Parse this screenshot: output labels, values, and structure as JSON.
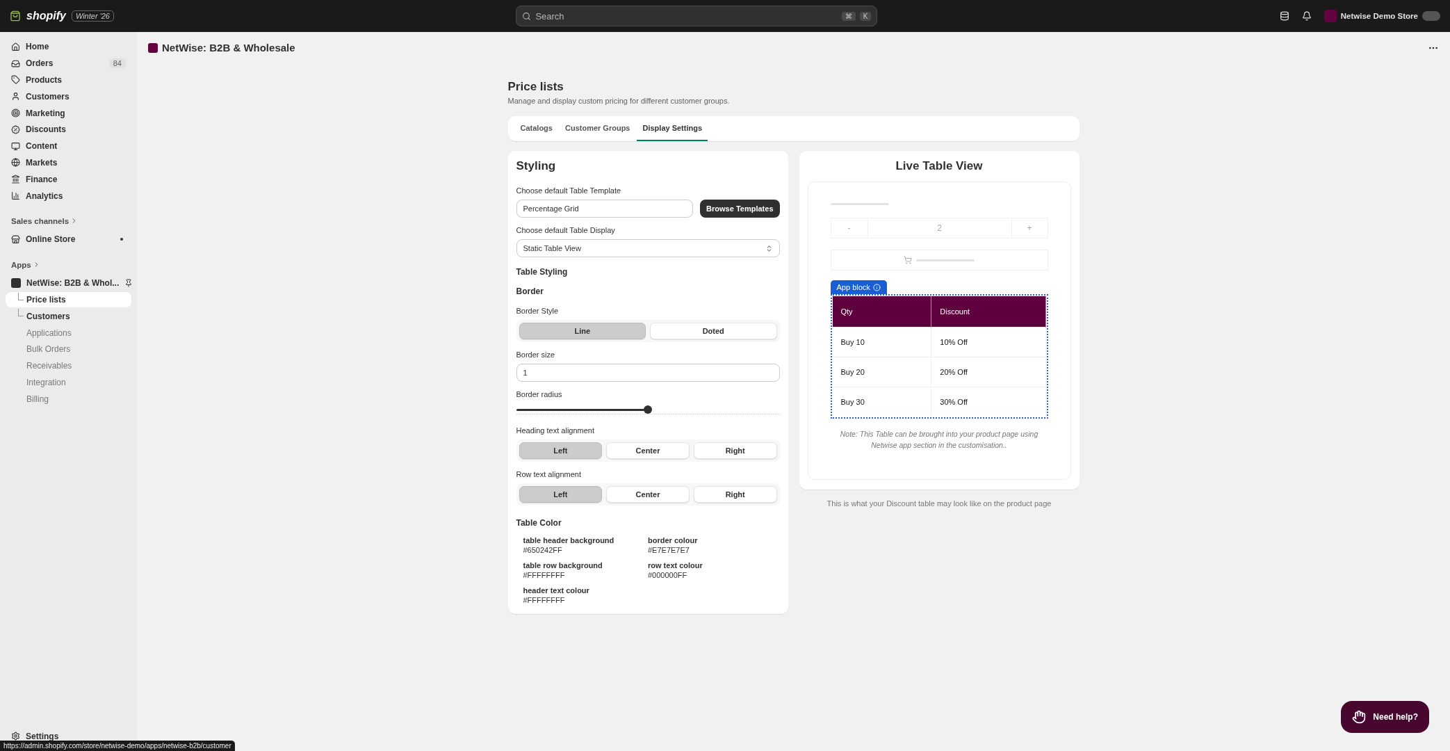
{
  "topbar": {
    "brand": "shopify",
    "edition": "Winter '26",
    "search": {
      "placeholder": "Search",
      "keys": [
        "⌘",
        "K"
      ]
    },
    "store": "Netwise Demo Store"
  },
  "sidebar": {
    "items": [
      {
        "label": "Home"
      },
      {
        "label": "Orders",
        "badge": "84"
      },
      {
        "label": "Products"
      },
      {
        "label": "Customers"
      },
      {
        "label": "Marketing"
      },
      {
        "label": "Discounts"
      },
      {
        "label": "Content"
      },
      {
        "label": "Markets"
      },
      {
        "label": "Finance"
      },
      {
        "label": "Analytics"
      }
    ],
    "sales_channels": {
      "heading": "Sales channels",
      "items": [
        {
          "label": "Online Store",
          "dot": true
        }
      ]
    },
    "apps": {
      "heading": "Apps",
      "app": {
        "label": "NetWise: B2B & Whol...",
        "pinned": true
      },
      "children": [
        {
          "label": "Price lists",
          "selected": true,
          "connector": true
        },
        {
          "label": "Customers",
          "selected": false,
          "connector": true
        },
        {
          "label": "Applications",
          "selected": false,
          "connector": false
        },
        {
          "label": "Bulk Orders",
          "selected": false,
          "connector": false
        },
        {
          "label": "Receivables",
          "selected": false,
          "connector": false
        },
        {
          "label": "Integration",
          "selected": false,
          "connector": false
        },
        {
          "label": "Billing",
          "selected": false,
          "connector": false
        }
      ]
    },
    "settings": "Settings"
  },
  "app_title": "NetWise: B2B & Wholesale",
  "page": {
    "title": "Price lists",
    "subtitle": "Manage and display custom pricing for different customer groups.",
    "tabs": [
      {
        "label": "Catalogs",
        "selected": false
      },
      {
        "label": "Customer Groups",
        "selected": false
      },
      {
        "label": "Display Settings",
        "selected": true
      }
    ]
  },
  "styling": {
    "title": "Styling",
    "template_label": "Choose default Table Template",
    "template_value": "Percentage Grid",
    "browse_button": "Browse Templates",
    "display_label": "Choose default Table Display",
    "display_value": "Static Table View",
    "table_styling": "Table Styling",
    "border_heading": "Border",
    "border_style": {
      "label": "Border Style",
      "options": [
        {
          "label": "Line",
          "selected": true
        },
        {
          "label": "Doted",
          "selected": false
        }
      ]
    },
    "border_size": {
      "label": "Border size",
      "value": "1"
    },
    "border_radius": {
      "label": "Border radius",
      "level": 0.5
    },
    "heading_alignment": {
      "label": "Heading text alignment",
      "options": [
        {
          "label": "Left",
          "selected": true
        },
        {
          "label": "Center",
          "selected": false
        },
        {
          "label": "Right",
          "selected": false
        }
      ]
    },
    "row_alignment": {
      "label": "Row text alignment",
      "options": [
        {
          "label": "Left",
          "selected": true
        },
        {
          "label": "Center",
          "selected": false
        },
        {
          "label": "Right",
          "selected": false
        }
      ]
    },
    "table_color": {
      "heading": "Table Color",
      "items": [
        {
          "label": "table header background",
          "value": "#650242FF"
        },
        {
          "label": "border colour",
          "value": "#E7E7E7E7"
        },
        {
          "label": "table row background",
          "value": "#FFFFFFFF"
        },
        {
          "label": "row text colour",
          "value": "#000000FF"
        },
        {
          "label": "header text colour",
          "value": "#FFFFFFFF"
        }
      ]
    }
  },
  "preview": {
    "title": "Live Table View",
    "quantity": {
      "minus": "-",
      "value": "2",
      "plus": "+"
    },
    "app_block": "App block",
    "columns": [
      "Qty",
      "Discount"
    ],
    "rows": [
      [
        "Buy 10",
        "10% Off"
      ],
      [
        "Buy 20",
        "20% Off"
      ],
      [
        "Buy 30",
        "30% Off"
      ]
    ],
    "note": "Note: This Table can be brought into your product page using Netwise app section in the customisation..",
    "caption": "This is what your Discount table may look like on the product page"
  },
  "help_button": "Need help?",
  "status_url": "https://admin.shopify.com/store/netwise-demo/apps/netwise-b2b/customer"
}
